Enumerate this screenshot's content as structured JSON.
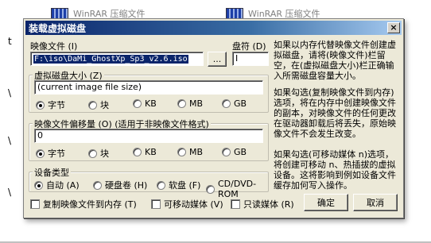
{
  "background": {
    "items": [
      {
        "label": "WinRAR 压缩文件"
      },
      {
        "label": "WinRAR 压缩文件"
      }
    ],
    "left_chars": [
      "t",
      "\\",
      "\\",
      "\\"
    ]
  },
  "dialog": {
    "title": "装载虚拟磁盘",
    "close_glyph": "×",
    "image_file_label": "映像文件 (I)",
    "image_file_value": "F:\\iso\\DaMi_GhostXp_Sp3_v2.6.iso",
    "browse_label": "...",
    "drive_letter_label": "盘符 (D)",
    "drive_letter_value": "I",
    "disk_size_group": {
      "title": "虚拟磁盘大小 (Z)",
      "value": "(current image file size)",
      "units": [
        {
          "label": "字节",
          "checked": true
        },
        {
          "label": "块",
          "checked": false
        },
        {
          "label": "KB",
          "checked": false
        },
        {
          "label": "MB",
          "checked": false
        },
        {
          "label": "GB",
          "checked": false
        }
      ]
    },
    "offset_group": {
      "title": "映像文件偏移量 (O) (适用于非映像文件格式)",
      "value": "0",
      "units": [
        {
          "label": "字节",
          "checked": true
        },
        {
          "label": "块",
          "checked": false
        },
        {
          "label": "KB",
          "checked": false
        },
        {
          "label": "MB",
          "checked": false
        },
        {
          "label": "GB",
          "checked": false
        }
      ]
    },
    "device_type_group": {
      "title": "设备类型",
      "options": [
        {
          "label": "自动 (A)",
          "checked": true
        },
        {
          "label": "硬盘卷 (H)",
          "checked": false
        },
        {
          "label": "软盘 (F)",
          "checked": false
        },
        {
          "label": "CD/DVD-ROM",
          "checked": false
        }
      ]
    },
    "checkboxes": [
      {
        "label": "复制映像文件到内存 (T)",
        "checked": false
      },
      {
        "label": "可移动媒体 (V)",
        "checked": false
      },
      {
        "label": "只读媒体 (R)",
        "checked": false
      }
    ],
    "ok_label": "确定",
    "cancel_label": "取消",
    "help_texts": [
      "如果以内存代替映像文件创建虚拟磁盘，请将(映像文件)栏留空，在(虚拟磁盘大小)栏正确输入所需磁盘容量大小。",
      "如果勾选(复制映像文件到内存)选项，将在内存中创建映像文件的副本，对映像文件的任何更改在驱动器卸载后将丢失，原始映像文件不会发生改变。",
      "如果勾选(可移动媒体 n)选项，将创建可移动 n、热插拔的虚拟设备。这将影响到例如设备文件缓存加何写入操作。"
    ]
  }
}
